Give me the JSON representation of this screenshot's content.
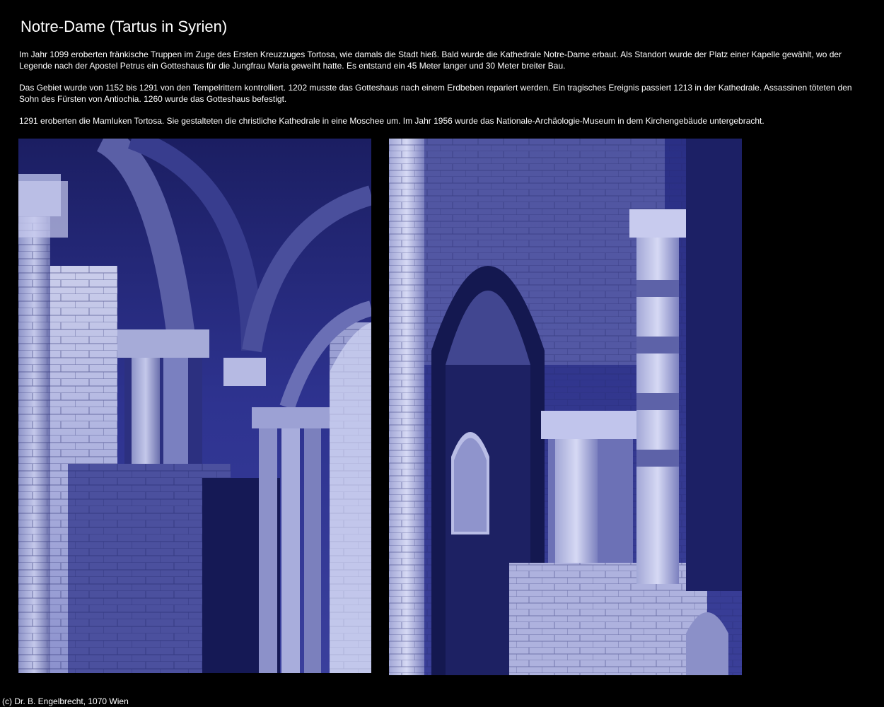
{
  "page": {
    "title": "Notre-Dame (Tartus in Syrien)"
  },
  "intro": {
    "paragraphs": [
      "Im Jahr 1099 eroberten fränkische Truppen im Zuge des Ersten Kreuzzuges Tortosa, wie damals die Stadt hieß. Bald wurde die Kathedrale Notre-Dame erbaut. Als Standort wurde der Platz einer Kapelle gewählt, wo der Legende nach der Apostel Petrus ein Gotteshaus für die Jungfrau Maria geweiht hatte. Es entstand ein 45 Meter langer und 30 Meter breiter Bau.",
      "Das Gebiet wurde von 1152 bis 1291 von den Tempelrittern kontrolliert. 1202 musste das Gotteshaus nach einem Erdbeben repariert werden. Ein tragisches Ereignis passiert 1213 in der Kathedrale. Assassinen töteten den Sohn des Fürsten von Antiochia. 1260 wurde das Gotteshaus befestigt.",
      "1291 eroberten die Mamluken Tortosa. Sie gestalteten die christliche Kathedrale in eine Moschee um. Im Jahr 1956 wurde das Nationale-Archäologie-Museum in dem Kirchengebäude untergebracht."
    ]
  },
  "photos": [
    {
      "subject": "cathedral-interior-vaulted-arches",
      "tint": "#2b2f8a"
    },
    {
      "subject": "cathedral-interior-pointed-arch-window",
      "tint": "#2a2e86"
    }
  ],
  "footer": {
    "copyright": "(c) Dr. B. Engelbrecht, 1070 Wien"
  }
}
